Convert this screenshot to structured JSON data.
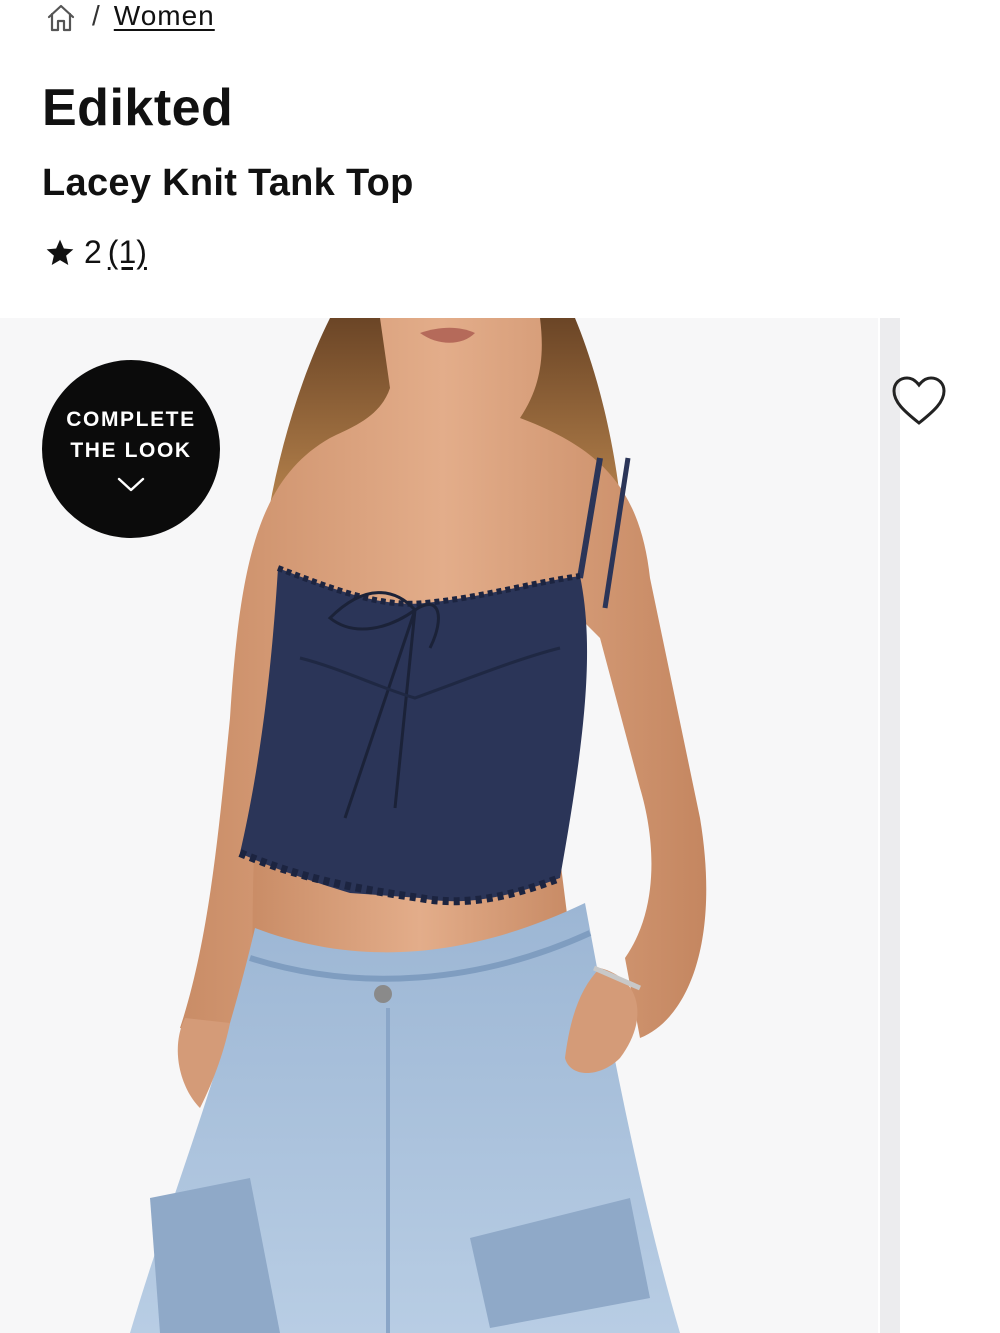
{
  "breadcrumb": {
    "home_icon": "home-icon",
    "separator": "/",
    "items": [
      {
        "label": "Women"
      }
    ]
  },
  "product": {
    "brand": "Edikted",
    "name": "Lacey Knit Tank Top",
    "rating": {
      "value": "2",
      "count": "(1)",
      "icon": "star-icon"
    }
  },
  "gallery": {
    "complete_the_look": {
      "line1": "COMPLETE",
      "line2": "THE LOOK",
      "icon": "chevron-down-icon"
    },
    "wishlist_icon": "heart-outline-icon"
  },
  "colors": {
    "text": "#111111",
    "badge_bg": "#0b0b0b",
    "top_navy": "#2b3558",
    "denim": "#a8c0dc",
    "skin": "#d9a27f",
    "hair": "#a07040"
  }
}
